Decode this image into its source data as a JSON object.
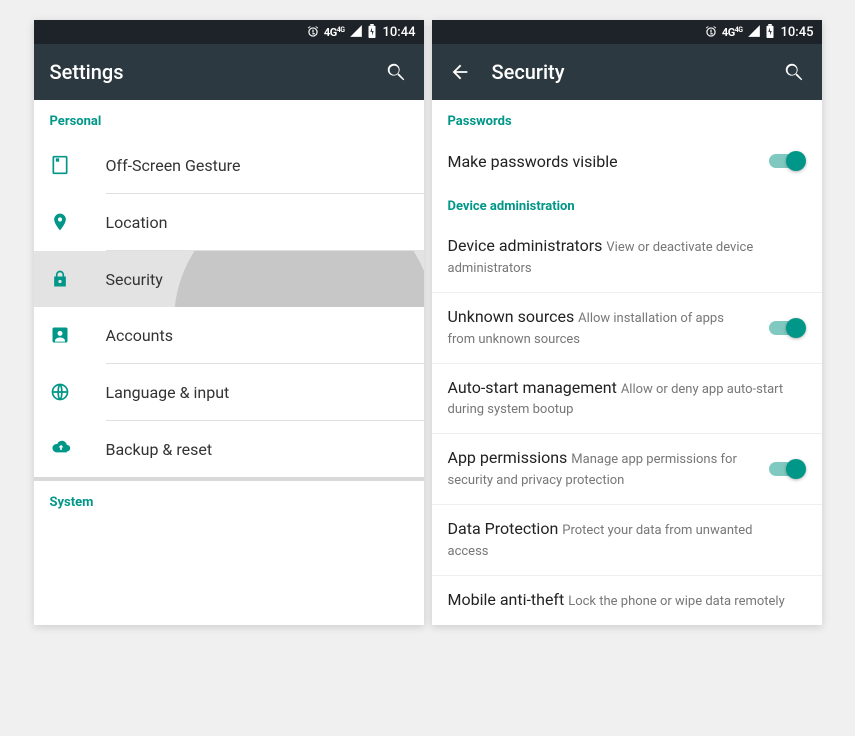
{
  "left": {
    "status": {
      "net": "4G",
      "net_sup": "4G",
      "time": "10:44"
    },
    "toolbar": {
      "title": "Settings"
    },
    "sections": {
      "personal": {
        "header": "Personal",
        "items": [
          {
            "key": "off-screen-gesture",
            "label": "Off-Screen Gesture"
          },
          {
            "key": "location",
            "label": "Location"
          },
          {
            "key": "security",
            "label": "Security",
            "selected": true
          },
          {
            "key": "accounts",
            "label": "Accounts"
          },
          {
            "key": "language-input",
            "label": "Language & input"
          },
          {
            "key": "backup-reset",
            "label": "Backup & reset"
          }
        ]
      },
      "system": {
        "header": "System"
      }
    }
  },
  "right": {
    "status": {
      "net": "4G",
      "net_sup": "4G",
      "time": "10:45"
    },
    "toolbar": {
      "title": "Security"
    },
    "groups": {
      "passwords": {
        "header": "Passwords",
        "items": [
          {
            "key": "make-passwords-visible",
            "label": "Make passwords visible",
            "toggle": true
          }
        ]
      },
      "device_admin": {
        "header": "Device administration",
        "items": [
          {
            "key": "device-administrators",
            "label": "Device administrators",
            "sublabel": "View or deactivate device administrators"
          },
          {
            "key": "unknown-sources",
            "label": "Unknown sources",
            "sublabel": "Allow installation of apps from unknown sources",
            "toggle": true
          },
          {
            "key": "auto-start-management",
            "label": "Auto-start management",
            "sublabel": "Allow or deny app auto-start during system bootup"
          },
          {
            "key": "app-permissions",
            "label": "App permissions",
            "sublabel": "Manage app permissions for security and privacy protection",
            "toggle": true
          },
          {
            "key": "data-protection",
            "label": "Data Protection",
            "sublabel": "Protect your data from unwanted access"
          },
          {
            "key": "mobile-anti-theft",
            "label": "Mobile anti-theft",
            "sublabel": "Lock the phone or wipe data remotely"
          }
        ]
      }
    }
  }
}
